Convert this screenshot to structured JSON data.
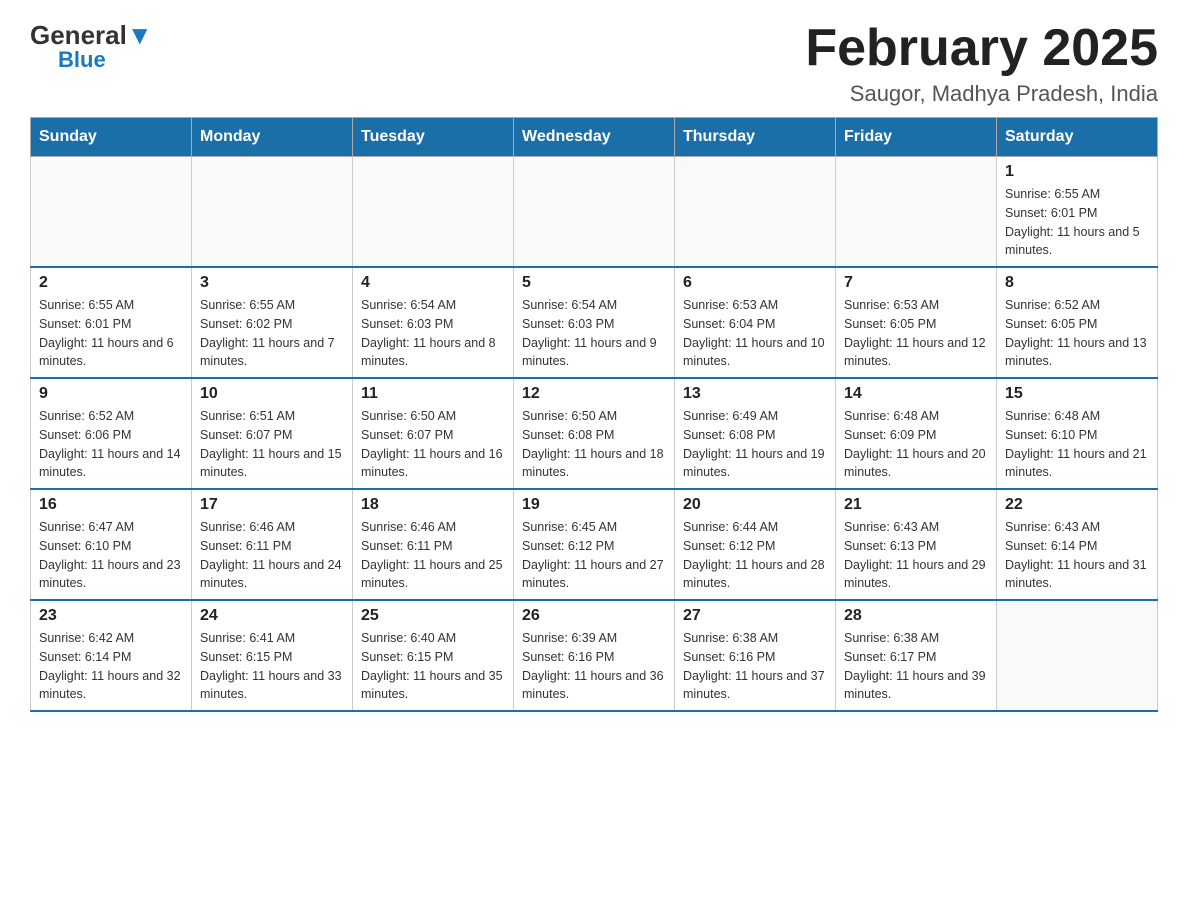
{
  "logo": {
    "general": "General",
    "blue": "Blue"
  },
  "title": "February 2025",
  "subtitle": "Saugor, Madhya Pradesh, India",
  "days_of_week": [
    "Sunday",
    "Monday",
    "Tuesday",
    "Wednesday",
    "Thursday",
    "Friday",
    "Saturday"
  ],
  "weeks": [
    [
      {
        "day": "",
        "info": ""
      },
      {
        "day": "",
        "info": ""
      },
      {
        "day": "",
        "info": ""
      },
      {
        "day": "",
        "info": ""
      },
      {
        "day": "",
        "info": ""
      },
      {
        "day": "",
        "info": ""
      },
      {
        "day": "1",
        "info": "Sunrise: 6:55 AM\nSunset: 6:01 PM\nDaylight: 11 hours and 5 minutes."
      }
    ],
    [
      {
        "day": "2",
        "info": "Sunrise: 6:55 AM\nSunset: 6:01 PM\nDaylight: 11 hours and 6 minutes."
      },
      {
        "day": "3",
        "info": "Sunrise: 6:55 AM\nSunset: 6:02 PM\nDaylight: 11 hours and 7 minutes."
      },
      {
        "day": "4",
        "info": "Sunrise: 6:54 AM\nSunset: 6:03 PM\nDaylight: 11 hours and 8 minutes."
      },
      {
        "day": "5",
        "info": "Sunrise: 6:54 AM\nSunset: 6:03 PM\nDaylight: 11 hours and 9 minutes."
      },
      {
        "day": "6",
        "info": "Sunrise: 6:53 AM\nSunset: 6:04 PM\nDaylight: 11 hours and 10 minutes."
      },
      {
        "day": "7",
        "info": "Sunrise: 6:53 AM\nSunset: 6:05 PM\nDaylight: 11 hours and 12 minutes."
      },
      {
        "day": "8",
        "info": "Sunrise: 6:52 AM\nSunset: 6:05 PM\nDaylight: 11 hours and 13 minutes."
      }
    ],
    [
      {
        "day": "9",
        "info": "Sunrise: 6:52 AM\nSunset: 6:06 PM\nDaylight: 11 hours and 14 minutes."
      },
      {
        "day": "10",
        "info": "Sunrise: 6:51 AM\nSunset: 6:07 PM\nDaylight: 11 hours and 15 minutes."
      },
      {
        "day": "11",
        "info": "Sunrise: 6:50 AM\nSunset: 6:07 PM\nDaylight: 11 hours and 16 minutes."
      },
      {
        "day": "12",
        "info": "Sunrise: 6:50 AM\nSunset: 6:08 PM\nDaylight: 11 hours and 18 minutes."
      },
      {
        "day": "13",
        "info": "Sunrise: 6:49 AM\nSunset: 6:08 PM\nDaylight: 11 hours and 19 minutes."
      },
      {
        "day": "14",
        "info": "Sunrise: 6:48 AM\nSunset: 6:09 PM\nDaylight: 11 hours and 20 minutes."
      },
      {
        "day": "15",
        "info": "Sunrise: 6:48 AM\nSunset: 6:10 PM\nDaylight: 11 hours and 21 minutes."
      }
    ],
    [
      {
        "day": "16",
        "info": "Sunrise: 6:47 AM\nSunset: 6:10 PM\nDaylight: 11 hours and 23 minutes."
      },
      {
        "day": "17",
        "info": "Sunrise: 6:46 AM\nSunset: 6:11 PM\nDaylight: 11 hours and 24 minutes."
      },
      {
        "day": "18",
        "info": "Sunrise: 6:46 AM\nSunset: 6:11 PM\nDaylight: 11 hours and 25 minutes."
      },
      {
        "day": "19",
        "info": "Sunrise: 6:45 AM\nSunset: 6:12 PM\nDaylight: 11 hours and 27 minutes."
      },
      {
        "day": "20",
        "info": "Sunrise: 6:44 AM\nSunset: 6:12 PM\nDaylight: 11 hours and 28 minutes."
      },
      {
        "day": "21",
        "info": "Sunrise: 6:43 AM\nSunset: 6:13 PM\nDaylight: 11 hours and 29 minutes."
      },
      {
        "day": "22",
        "info": "Sunrise: 6:43 AM\nSunset: 6:14 PM\nDaylight: 11 hours and 31 minutes."
      }
    ],
    [
      {
        "day": "23",
        "info": "Sunrise: 6:42 AM\nSunset: 6:14 PM\nDaylight: 11 hours and 32 minutes."
      },
      {
        "day": "24",
        "info": "Sunrise: 6:41 AM\nSunset: 6:15 PM\nDaylight: 11 hours and 33 minutes."
      },
      {
        "day": "25",
        "info": "Sunrise: 6:40 AM\nSunset: 6:15 PM\nDaylight: 11 hours and 35 minutes."
      },
      {
        "day": "26",
        "info": "Sunrise: 6:39 AM\nSunset: 6:16 PM\nDaylight: 11 hours and 36 minutes."
      },
      {
        "day": "27",
        "info": "Sunrise: 6:38 AM\nSunset: 6:16 PM\nDaylight: 11 hours and 37 minutes."
      },
      {
        "day": "28",
        "info": "Sunrise: 6:38 AM\nSunset: 6:17 PM\nDaylight: 11 hours and 39 minutes."
      },
      {
        "day": "",
        "info": ""
      }
    ]
  ]
}
